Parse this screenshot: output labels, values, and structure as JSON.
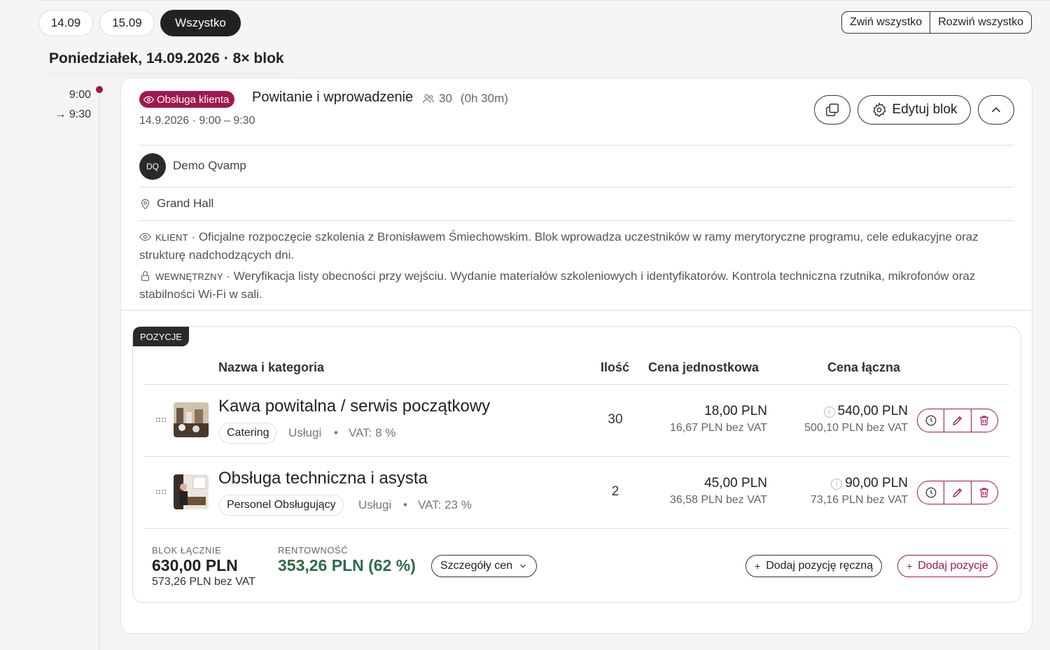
{
  "tabs": [
    {
      "label": "14.09",
      "active": false
    },
    {
      "label": "15.09",
      "active": false
    },
    {
      "label": "Wszystko",
      "active": true
    }
  ],
  "toolbar": {
    "collapse_all": "Zwiń wszystko",
    "expand_all": "Rozwiń wszystko"
  },
  "day": {
    "title": "Poniedziałek, 14.09.2026 · 8× blok"
  },
  "timeline": {
    "start": "9:00",
    "end": "→ 9:30"
  },
  "block": {
    "category": "Obsługa klienta",
    "category_color": "#a0184d",
    "title": "Powitanie i wprowadzenie",
    "people": "30",
    "duration": "(0h 30m)",
    "date": "14.9.2026 · 9:00 – 9:30",
    "edit_label": "Edytuj blok",
    "owner_initials": "DQ",
    "owner_name": "Demo Qvamp",
    "location": "Grand Hall",
    "client_tag": "KLIENT",
    "client_note": " · Oficjalne rozpoczęcie szkolenia z Bronisławem Śmiechowskim. Blok wprowadza uczestników w ramy merytoryczne programu, cele edukacyjne oraz strukturę nadchodzących dni.",
    "internal_tag": "WEWNĘTRZNY",
    "internal_note": " · Weryfikacja listy obecności przy wejściu. Wydanie materiałów szkoleniowych i identyfikatorów. Kontrola techniczna rzutnika, mikrofonów oraz stabilności Wi-Fi w sali."
  },
  "positions": {
    "tag": "POZYCJE",
    "headers": {
      "name": "Nazwa i kategoria",
      "qty": "Ilość",
      "unit": "Cena jednostkowa",
      "total": "Cena łączna"
    },
    "items": [
      {
        "name": "Kawa powitalna / serwis początkowy",
        "category": "Catering",
        "type": "Usługi",
        "dot": "•",
        "vat": "VAT: 8 %",
        "qty": "30",
        "unit_price": "18,00 PLN",
        "unit_net": "16,67 PLN bez VAT",
        "total_price": "540,00 PLN",
        "total_net": "500,10 PLN bez VAT"
      },
      {
        "name": "Obsługa techniczna i asysta",
        "category": "Personel Obsługujący",
        "type": "Usługi",
        "dot": "•",
        "vat": "VAT: 23 %",
        "qty": "2",
        "unit_price": "45,00 PLN",
        "unit_net": "36,58 PLN bez VAT",
        "total_price": "90,00 PLN",
        "total_net": "73,16 PLN bez VAT"
      }
    ],
    "summary": {
      "total_label": "BLOK ŁĄCZNIE",
      "total": "630,00 PLN",
      "total_net": "573,26 PLN bez VAT",
      "profit_label": "RENTOWNOŚĆ",
      "profit": "353,26 PLN (62 %)",
      "profit_color": "#2f6b47",
      "details_label": "Szczegóły cen",
      "add_manual": "Dodaj pozycję ręczną",
      "add_items": "Dodaj pozycje"
    }
  }
}
